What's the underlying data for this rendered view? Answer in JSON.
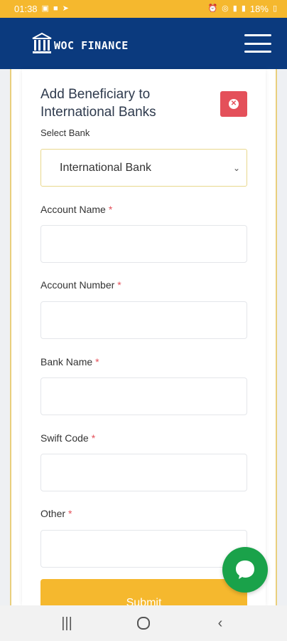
{
  "status_bar": {
    "time": "01:38",
    "battery": "18%"
  },
  "header": {
    "brand": "WOC FINANCE",
    "brand_icon": "bank-building-icon",
    "menu_icon": "hamburger-menu-icon"
  },
  "form": {
    "title": "Add Beneficiary to International Banks",
    "close_icon": "close-circle-icon",
    "select_bank_label": "Select Bank",
    "select_bank_value": "International Bank",
    "required_mark": "*",
    "fields": {
      "account_name": "Account Name",
      "account_number": "Account Number",
      "bank_name": "Bank Name",
      "swift_code": "Swift Code",
      "other": "Other"
    },
    "submit_label": "Submit"
  },
  "chat": {
    "icon": "chat-bubble-icon"
  },
  "colors": {
    "status_bar": "#f5b82e",
    "header": "#0b3a7e",
    "close_button": "#e4505a",
    "submit_button": "#f5b82e",
    "chat_button": "#1aa24a"
  }
}
